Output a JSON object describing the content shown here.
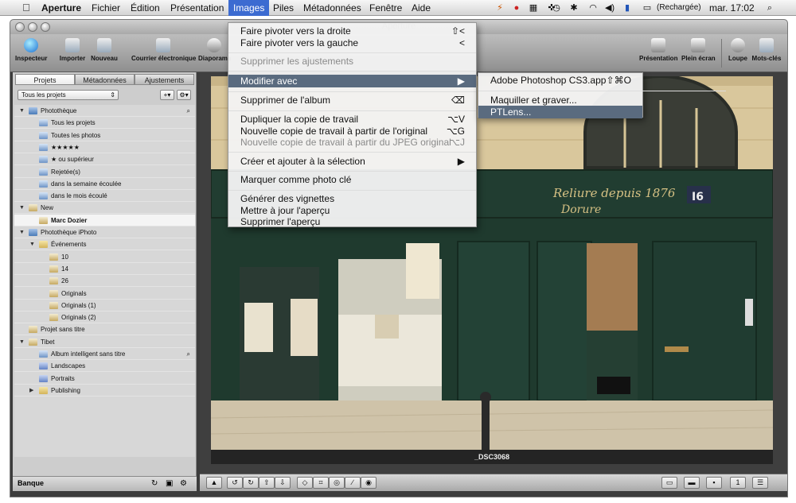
{
  "menubar": {
    "app": "Aperture",
    "items": [
      "Fichier",
      "Édition",
      "Présentation",
      "Images",
      "Piles",
      "Métadonnées",
      "Fenêtre",
      "Aide"
    ],
    "active_item": "Images",
    "battery_text": "(Rechargée)",
    "clock": "mar. 17:02"
  },
  "window": {
    "title": "Aperture"
  },
  "toolbar": {
    "items": [
      "Inspecteur",
      "Importer",
      "Nouveau",
      "Courrier électronique",
      "Diaporama"
    ],
    "right_items": [
      "Présentation",
      "Plein écran",
      "Loupe",
      "Mots-clés"
    ]
  },
  "left_panel": {
    "tabs": [
      "Projets",
      "Métadonnées",
      "Ajustements"
    ],
    "selected_tab": "Projets",
    "projects_filter": "Tous les projets",
    "tree": [
      {
        "label": "Photothèque",
        "level": 0,
        "icon": "library-icon",
        "expand": "open",
        "search": true
      },
      {
        "label": "Tous les projets",
        "level": 1,
        "icon": "smart-album-icon"
      },
      {
        "label": "Toutes les photos",
        "level": 1,
        "icon": "smart-album-icon"
      },
      {
        "label": "★★★★★",
        "level": 1,
        "icon": "smart-album-icon"
      },
      {
        "label": "★ ou supérieur",
        "level": 1,
        "icon": "smart-album-icon"
      },
      {
        "label": "Rejetée(s)",
        "level": 1,
        "icon": "smart-album-icon"
      },
      {
        "label": "dans la semaine écoulée",
        "level": 1,
        "icon": "smart-album-icon"
      },
      {
        "label": "dans le mois écoulé",
        "level": 1,
        "icon": "smart-album-icon"
      },
      {
        "label": "New",
        "level": 0,
        "icon": "project-icon",
        "expand": "open"
      },
      {
        "label": "Marc Dozier",
        "level": 1,
        "icon": "project-icon",
        "selected": true
      },
      {
        "label": "Photothèque iPhoto",
        "level": 0,
        "icon": "library-icon",
        "expand": "open"
      },
      {
        "label": "Événements",
        "level": 1,
        "icon": "folder-icon",
        "expand": "open"
      },
      {
        "label": "10",
        "level": 2,
        "icon": "project-icon"
      },
      {
        "label": "14",
        "level": 2,
        "icon": "project-icon"
      },
      {
        "label": "26",
        "level": 2,
        "icon": "project-icon"
      },
      {
        "label": "Originals",
        "level": 2,
        "icon": "project-icon"
      },
      {
        "label": "Originals (1)",
        "level": 2,
        "icon": "project-icon"
      },
      {
        "label": "Originals (2)",
        "level": 2,
        "icon": "project-icon"
      },
      {
        "label": "Projet sans titre",
        "level": 0,
        "icon": "project-icon"
      },
      {
        "label": "Tibet",
        "level": 0,
        "icon": "project-icon",
        "expand": "open"
      },
      {
        "label": "Album intelligent sans titre",
        "level": 1,
        "icon": "smart-album-icon",
        "search": true
      },
      {
        "label": "Landscapes",
        "level": 1,
        "icon": "album-icon"
      },
      {
        "label": "Portraits",
        "level": 1,
        "icon": "album-icon"
      },
      {
        "label": "Publishing",
        "level": 1,
        "icon": "folder-icon",
        "expand": "closed"
      }
    ],
    "bottom_label": "Banque"
  },
  "viewer": {
    "image_caption": "_DSC3068",
    "photo_texts": {
      "shop_sign": "Reliure depuis 1876",
      "shop_name": "Dorure",
      "house_number": "I6"
    }
  },
  "images_menu": {
    "items": [
      {
        "label": "Faire pivoter vers la droite",
        "shortcut": "⇧<",
        "enabled": true
      },
      {
        "label": "Faire pivoter vers la gauche",
        "shortcut": "<",
        "enabled": true
      },
      {
        "separator": true
      },
      {
        "label": "Supprimer les ajustements",
        "shortcut": "",
        "enabled": false
      },
      {
        "separator": true
      },
      {
        "label": "Modifier avec",
        "shortcut": "▶",
        "enabled": true,
        "highlighted": true
      },
      {
        "separator": true
      },
      {
        "label": "Supprimer de l'album",
        "shortcut": "⌫",
        "enabled": true
      },
      {
        "separator": true
      },
      {
        "label": "Dupliquer la copie de travail",
        "shortcut": "⌥V",
        "enabled": true
      },
      {
        "label": "Nouvelle copie de travail à partir de l'original",
        "shortcut": "⌥G",
        "enabled": true
      },
      {
        "label": "Nouvelle copie de travail à partir du JPEG original",
        "shortcut": "⌥J",
        "enabled": false
      },
      {
        "separator": true
      },
      {
        "label": "Créer et ajouter à la sélection",
        "shortcut": "▶",
        "enabled": true
      },
      {
        "separator": true
      },
      {
        "label": "Marquer comme photo clé",
        "shortcut": "",
        "enabled": true
      },
      {
        "separator": true
      },
      {
        "label": "Générer des vignettes",
        "shortcut": "",
        "enabled": true
      },
      {
        "label": "Mettre à jour l'aperçu",
        "shortcut": "",
        "enabled": true
      },
      {
        "label": "Supprimer l'aperçu",
        "shortcut": "",
        "enabled": true
      }
    ]
  },
  "edit_with_submenu": {
    "items": [
      {
        "label": "Adobe Photoshop CS3.app",
        "shortcut": "⇧⌘O"
      },
      {
        "separator": true
      },
      {
        "label": "Maquiller et graver...",
        "shortcut": ""
      },
      {
        "label": "PTLens...",
        "shortcut": "",
        "highlighted": true
      }
    ]
  }
}
